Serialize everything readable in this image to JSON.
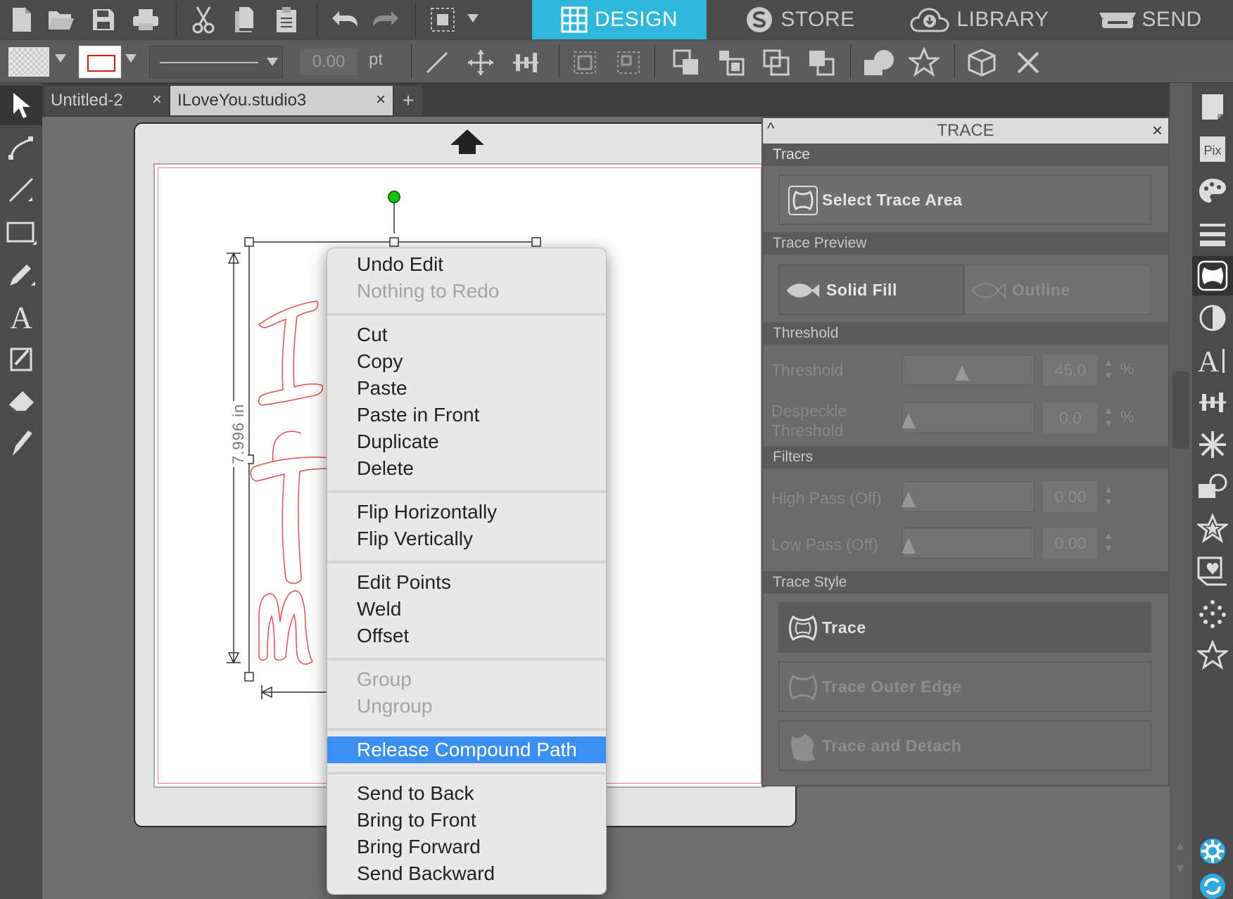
{
  "modes": {
    "design": "DESIGN",
    "store": "STORE",
    "library": "LIBRARY",
    "send": "SEND",
    "active_color": "#2fb8dc"
  },
  "toolbar2": {
    "line_width": "0.00",
    "line_unit": "pt",
    "line_color": "#d21a1a"
  },
  "doc_tabs": [
    {
      "label": "Untitled-2",
      "close": "×"
    },
    {
      "label": "ILoveYou.studio3",
      "close": "×"
    }
  ],
  "doc_tab_add": "+",
  "canvas": {
    "dimension_label": "7.996 in"
  },
  "trace_panel": {
    "title": "TRACE",
    "collapse": "^",
    "close": "×",
    "sections": {
      "trace": "Trace",
      "preview": "Trace Preview",
      "threshold": "Threshold",
      "filters": "Filters",
      "style": "Trace Style"
    },
    "select_area": "Select Trace Area",
    "preview_solid": "Solid Fill",
    "preview_outline": "Outline",
    "threshold_label": "Threshold",
    "threshold_value": "45.0",
    "threshold_fraction": 0.45,
    "despeckle_label_1": "Despeckle",
    "despeckle_label_2": "Threshold",
    "despeckle_value": "0.0",
    "pct": "%",
    "highpass_label": "High Pass (Off)",
    "highpass_value": "0.00",
    "lowpass_label": "Low Pass (Off)",
    "lowpass_value": "0.00",
    "style_trace": "Trace",
    "style_outer": "Trace Outer Edge",
    "style_detach": "Trace and Detach"
  },
  "context_menu": {
    "undo": "Undo Edit",
    "redo": "Nothing to Redo",
    "cut": "Cut",
    "copy": "Copy",
    "paste": "Paste",
    "paste_front": "Paste in Front",
    "duplicate": "Duplicate",
    "delete": "Delete",
    "flip_h": "Flip Horizontally",
    "flip_v": "Flip Vertically",
    "edit_points": "Edit Points",
    "weld": "Weld",
    "offset": "Offset",
    "group": "Group",
    "ungroup": "Ungroup",
    "release": "Release Compound Path",
    "send_back": "Send to Back",
    "bring_front": "Bring to Front",
    "bring_forward": "Bring Forward",
    "send_backward": "Send Backward",
    "highlight_color": "#3a8ff0"
  }
}
